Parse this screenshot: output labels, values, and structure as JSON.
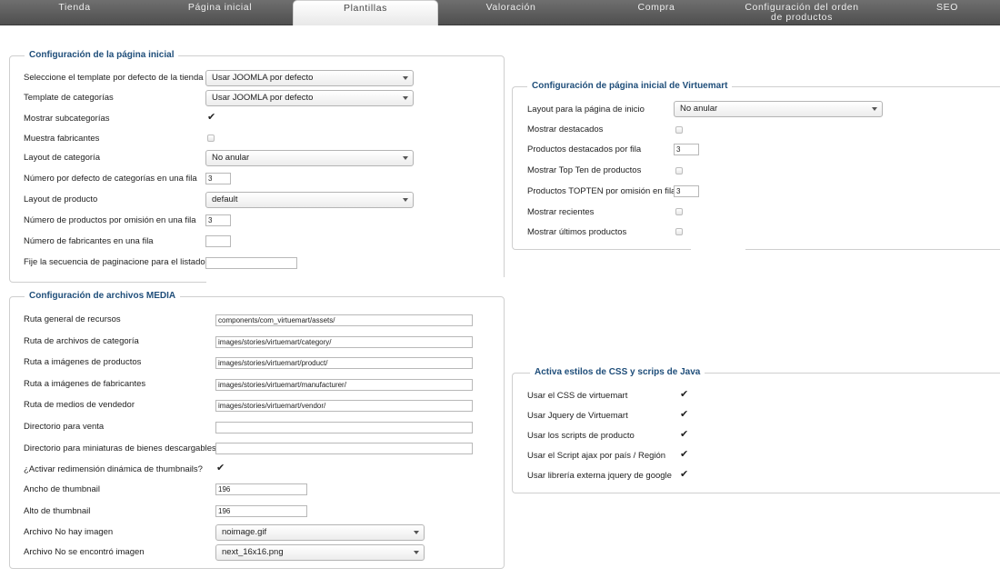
{
  "tabs": [
    "Tienda",
    "Página inicial",
    "Plantillas",
    "Valoración",
    "Compra",
    "Configuración del orden de productos",
    "SEO"
  ],
  "front": {
    "legend": "Configuración de la página inicial",
    "rows": [
      {
        "label": "Seleccione el template por defecto de la tienda",
        "value": "Usar JOOMLA por defecto"
      },
      {
        "label": "Template de categorías",
        "value": "Usar JOOMLA por defecto"
      },
      {
        "label": "Mostrar subcategorías",
        "value": "checked"
      },
      {
        "label": "Muestra fabricantes",
        "value": "unchecked"
      },
      {
        "label": "Layout de categoría",
        "value": "No anular"
      },
      {
        "label": "Número por defecto de categorías en una fila",
        "value": "3"
      },
      {
        "label": "Layout de producto",
        "value": "default"
      },
      {
        "label": "Número de productos por omisión en una fila",
        "value": "3"
      },
      {
        "label": "Número de fabricantes en una fila",
        "value": ""
      },
      {
        "label": "Fije la secuencia de paginacione para el listado",
        "value": ""
      }
    ]
  },
  "media": {
    "legend": "Configuración de archivos MEDIA",
    "rows": [
      {
        "label": "Ruta general de recursos",
        "value": "components/com_virtuemart/assets/"
      },
      {
        "label": "Ruta de archivos de categoría",
        "value": "images/stories/virtuemart/category/"
      },
      {
        "label": "Ruta a imágenes de productos",
        "value": "images/stories/virtuemart/product/"
      },
      {
        "label": "Ruta a imágenes de fabricantes",
        "value": "images/stories/virtuemart/manufacturer/"
      },
      {
        "label": "Ruta de medios de vendedor",
        "value": "images/stories/virtuemart/vendor/"
      },
      {
        "label": "Directorio para venta",
        "value": ""
      },
      {
        "label": "Directorio para miniaturas de bienes descargables",
        "value": ""
      },
      {
        "label": "¿Activar redimensión dinámica de thumbnails?",
        "value": "checked"
      },
      {
        "label": "Ancho de thumbnail",
        "value": "196"
      },
      {
        "label": "Alto de thumbnail",
        "value": "196"
      },
      {
        "label": "Archivo No hay imagen",
        "value": "noimage.gif"
      },
      {
        "label": "Archivo No se encontró imagen",
        "value": "next_16x16.png"
      }
    ]
  },
  "vm": {
    "legend": "Configuración de página inicial de Virtuemart",
    "rows": [
      {
        "label": "Layout para la página de inicio",
        "value": "No anular"
      },
      {
        "label": "Mostrar destacados",
        "value": "unchecked"
      },
      {
        "label": "Productos destacados por fila",
        "value": "3"
      },
      {
        "label": "Mostrar Top Ten de productos",
        "value": "unchecked"
      },
      {
        "label": "Productos TOPTEN por omisión en fila",
        "value": "3"
      },
      {
        "label": "Mostrar recientes",
        "value": "unchecked"
      },
      {
        "label": "Mostrar últimos productos",
        "value": "unchecked"
      }
    ]
  },
  "css": {
    "legend": "Activa estilos de CSS y scrips de Java",
    "rows": [
      {
        "label": "Usar el CSS de virtuemart",
        "value": "checked"
      },
      {
        "label": "Usar Jquery de Virtuemart",
        "value": "checked"
      },
      {
        "label": "Usar los scripts de producto",
        "value": "checked"
      },
      {
        "label": "Usar el Script ajax por país / Región",
        "value": "checked"
      },
      {
        "label": "Usar librería externa jquery de google",
        "value": "checked"
      }
    ]
  },
  "icons": {
    "checkmark": "check-icon",
    "dropdown": "chevron-down-icon"
  }
}
